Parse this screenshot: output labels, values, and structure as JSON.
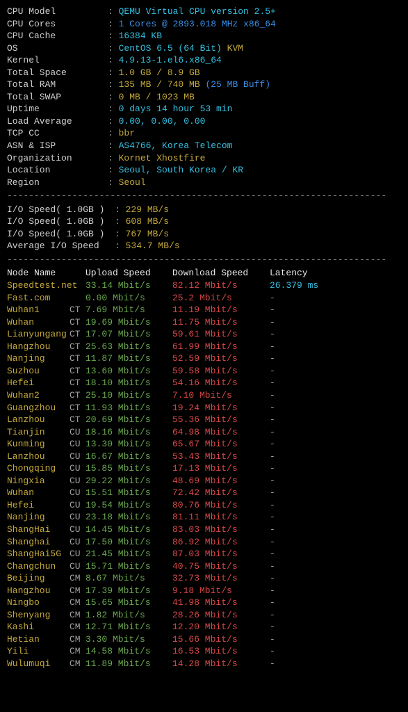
{
  "sys": [
    {
      "label": "CPU Model",
      "value": "QEMU Virtual CPU version 2.5+",
      "cls": "cyan"
    },
    {
      "label": "CPU Cores",
      "value": "1 Cores @ 2893.018 MHz x86_64",
      "cls": "blue"
    },
    {
      "label": "CPU Cache",
      "value": "16384 KB",
      "cls": "cyan"
    },
    {
      "label": "OS",
      "value": "CentOS 6.5 (64 Bit)",
      "suffix": " KVM",
      "cls": "cyan",
      "suffixCls": "yellow"
    },
    {
      "label": "Kernel",
      "value": "4.9.13-1.el6.x86_64",
      "cls": "cyan"
    },
    {
      "label": "Total Space",
      "value": "1.0 GB / 8.9 GB",
      "cls": "yellow"
    },
    {
      "label": "Total RAM",
      "value": "135 MB / 740 MB",
      "suffix": " (25 MB Buff)",
      "cls": "yellow",
      "suffixCls": "blue"
    },
    {
      "label": "Total SWAP",
      "value": "0 MB / 1023 MB",
      "cls": "yellow"
    },
    {
      "label": "Uptime",
      "value": "0 days 14 hour 53 min",
      "cls": "cyan"
    },
    {
      "label": "Load Average",
      "value": "0.00, 0.00, 0.00",
      "cls": "cyan"
    },
    {
      "label": "TCP CC",
      "value": "bbr",
      "cls": "yellow"
    },
    {
      "label": "ASN & ISP",
      "value": "AS4766, Korea Telecom",
      "cls": "cyan"
    },
    {
      "label": "Organization",
      "value": "Kornet Xhostfire",
      "cls": "yellow"
    },
    {
      "label": "Location",
      "value": "Seoul, South Korea / KR",
      "cls": "cyan"
    },
    {
      "label": "Region",
      "value": "Seoul",
      "cls": "yellow"
    }
  ],
  "io": [
    {
      "label": "I/O Speed( 1.0GB )",
      "value": "229 MB/s"
    },
    {
      "label": "I/O Speed( 1.0GB )",
      "value": "608 MB/s"
    },
    {
      "label": "I/O Speed( 1.0GB )",
      "value": "767 MB/s"
    },
    {
      "label": "Average I/O Speed",
      "value": "534.7 MB/s"
    }
  ],
  "headers": {
    "node": "Node Name",
    "upload": "Upload Speed",
    "download": "Download Speed",
    "latency": "Latency"
  },
  "rows": [
    {
      "node": "Speedtest.net",
      "tag": "",
      "up": "33.14 Mbit/s",
      "down": "82.12 Mbit/s",
      "lat": "26.379 ms"
    },
    {
      "node": "Fast.com",
      "tag": "",
      "up": "0.00 Mbit/s",
      "down": "25.2 Mbit/s",
      "lat": "-"
    },
    {
      "node": "Wuhan1",
      "tag": "CT",
      "up": "7.69 Mbit/s",
      "down": "11.19 Mbit/s",
      "lat": "-"
    },
    {
      "node": "Wuhan",
      "tag": "CT",
      "up": "19.69 Mbit/s",
      "down": "11.75 Mbit/s",
      "lat": "-"
    },
    {
      "node": "Lianyungang",
      "tag": "CT",
      "up": "17.07 Mbit/s",
      "down": "59.61 Mbit/s",
      "lat": "-"
    },
    {
      "node": "Hangzhou",
      "tag": "CT",
      "up": "25.63 Mbit/s",
      "down": "61.99 Mbit/s",
      "lat": "-"
    },
    {
      "node": "Nanjing",
      "tag": "CT",
      "up": "11.87 Mbit/s",
      "down": "52.59 Mbit/s",
      "lat": "-"
    },
    {
      "node": "Suzhou",
      "tag": "CT",
      "up": "13.60 Mbit/s",
      "down": "59.58 Mbit/s",
      "lat": "-"
    },
    {
      "node": "Hefei",
      "tag": "CT",
      "up": "18.10 Mbit/s",
      "down": "54.16 Mbit/s",
      "lat": "-"
    },
    {
      "node": "Wuhan2",
      "tag": "CT",
      "up": "25.10 Mbit/s",
      "down": "7.10 Mbit/s",
      "lat": "-"
    },
    {
      "node": "Guangzhou",
      "tag": "CT",
      "up": "11.93 Mbit/s",
      "down": "19.24 Mbit/s",
      "lat": "-"
    },
    {
      "node": "Lanzhou",
      "tag": "CT",
      "up": "20.69 Mbit/s",
      "down": "55.36 Mbit/s",
      "lat": "-"
    },
    {
      "node": "Tianjin",
      "tag": "CU",
      "up": "18.16 Mbit/s",
      "down": "64.98 Mbit/s",
      "lat": "-"
    },
    {
      "node": "Kunming",
      "tag": "CU",
      "up": "13.30 Mbit/s",
      "down": "65.67 Mbit/s",
      "lat": "-"
    },
    {
      "node": "Lanzhou",
      "tag": "CU",
      "up": "16.67 Mbit/s",
      "down": "53.43 Mbit/s",
      "lat": "-"
    },
    {
      "node": "Chongqing",
      "tag": "CU",
      "up": "15.85 Mbit/s",
      "down": "17.13 Mbit/s",
      "lat": "-"
    },
    {
      "node": "Ningxia",
      "tag": "CU",
      "up": "29.22 Mbit/s",
      "down": "48.69 Mbit/s",
      "lat": "-"
    },
    {
      "node": "Wuhan",
      "tag": "CU",
      "up": "15.51 Mbit/s",
      "down": "72.42 Mbit/s",
      "lat": "-"
    },
    {
      "node": "Hefei",
      "tag": "CU",
      "up": "19.54 Mbit/s",
      "down": "80.76 Mbit/s",
      "lat": "-"
    },
    {
      "node": "Nanjing",
      "tag": "CU",
      "up": "23.18 Mbit/s",
      "down": "81.11 Mbit/s",
      "lat": "-"
    },
    {
      "node": "ShangHai",
      "tag": "CU",
      "up": "14.45 Mbit/s",
      "down": "83.03 Mbit/s",
      "lat": "-"
    },
    {
      "node": "Shanghai",
      "tag": "CU",
      "up": "17.50 Mbit/s",
      "down": "86.92 Mbit/s",
      "lat": "-"
    },
    {
      "node": "ShangHai5G",
      "tag": "CU",
      "up": "21.45 Mbit/s",
      "down": "87.03 Mbit/s",
      "lat": "-"
    },
    {
      "node": "Changchun",
      "tag": "CU",
      "up": "15.71 Mbit/s",
      "down": "40.75 Mbit/s",
      "lat": "-"
    },
    {
      "node": "Beijing",
      "tag": "CM",
      "up": "8.67 Mbit/s",
      "down": "32.73 Mbit/s",
      "lat": "-"
    },
    {
      "node": "Hangzhou",
      "tag": "CM",
      "up": "17.39 Mbit/s",
      "down": "9.18 Mbit/s",
      "lat": "-"
    },
    {
      "node": "Ningbo",
      "tag": "CM",
      "up": "15.65 Mbit/s",
      "down": "41.98 Mbit/s",
      "lat": "-"
    },
    {
      "node": "Shenyang",
      "tag": "CM",
      "up": "1.82 Mbit/s",
      "down": "28.26 Mbit/s",
      "lat": "-"
    },
    {
      "node": "Kashi",
      "tag": "CM",
      "up": "12.71 Mbit/s",
      "down": "12.20 Mbit/s",
      "lat": "-"
    },
    {
      "node": "Hetian",
      "tag": "CM",
      "up": "3.30 Mbit/s",
      "down": "15.66 Mbit/s",
      "lat": "-"
    },
    {
      "node": "Yili",
      "tag": "CM",
      "up": "14.58 Mbit/s",
      "down": "16.53 Mbit/s",
      "lat": "-"
    },
    {
      "node": "Wulumuqi",
      "tag": "CM",
      "up": "11.89 Mbit/s",
      "down": "14.28 Mbit/s",
      "lat": "-"
    }
  ],
  "dash": "----------------------------------------------------------------------"
}
